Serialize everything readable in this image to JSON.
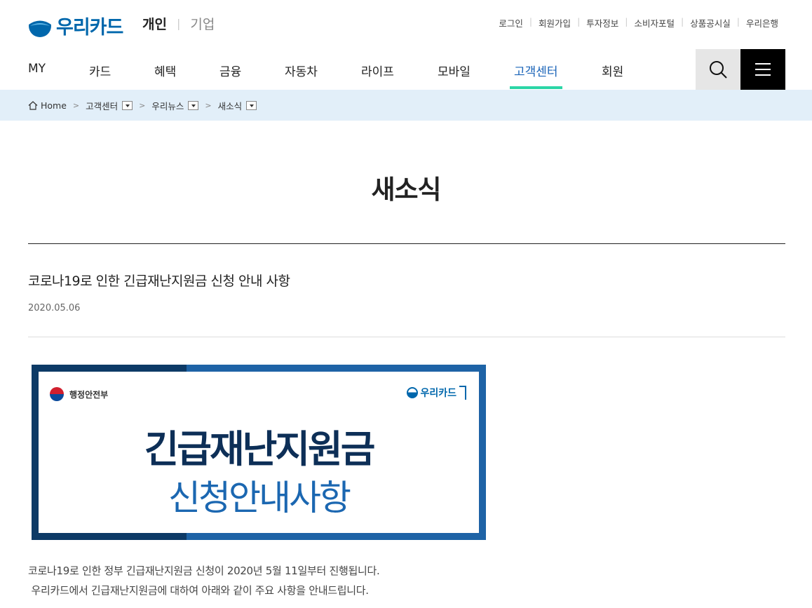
{
  "header": {
    "logo_text": "우리카드",
    "site_active": "개인",
    "site_inactive": "기업",
    "util_links": [
      "로그인",
      "회원가입",
      "투자정보",
      "소비자포털",
      "상품공시실",
      "우리은행"
    ]
  },
  "gnb": {
    "items": [
      "MY",
      "카드",
      "혜택",
      "금융",
      "자동차",
      "라이프",
      "모바일",
      "고객센터",
      "회원"
    ],
    "active_index": 7,
    "search_icon": "search-icon",
    "menu_icon": "hamburger-menu-icon"
  },
  "breadcrumb": {
    "home": "Home",
    "level1": "고객센터",
    "level2": "우리뉴스",
    "level3": "새소식"
  },
  "page": {
    "title": "새소식"
  },
  "article": {
    "title": "코로나19로 인한 긴급재난지원금 신청 안내 사항",
    "date": "2020.05.06",
    "banner": {
      "gov_label": "행정안전부",
      "brand": "우리카드",
      "headline1": "긴급재난지원금",
      "headline2": "신청안내사항"
    },
    "body_line1": "코로나19로 인한 정부 긴급재난지원금 신청이 2020년 5월 11일부터 진행됩니다.",
    "body_line2": " 우리카드에서 긴급재난지원금에 대하여 아래와 같이 주요 사항을 안내드립니다."
  },
  "colors": {
    "brand_blue": "#0067ac",
    "gnb_active_underline": "#2bd6a6",
    "breadcrumb_bg": "#e2eff9"
  }
}
